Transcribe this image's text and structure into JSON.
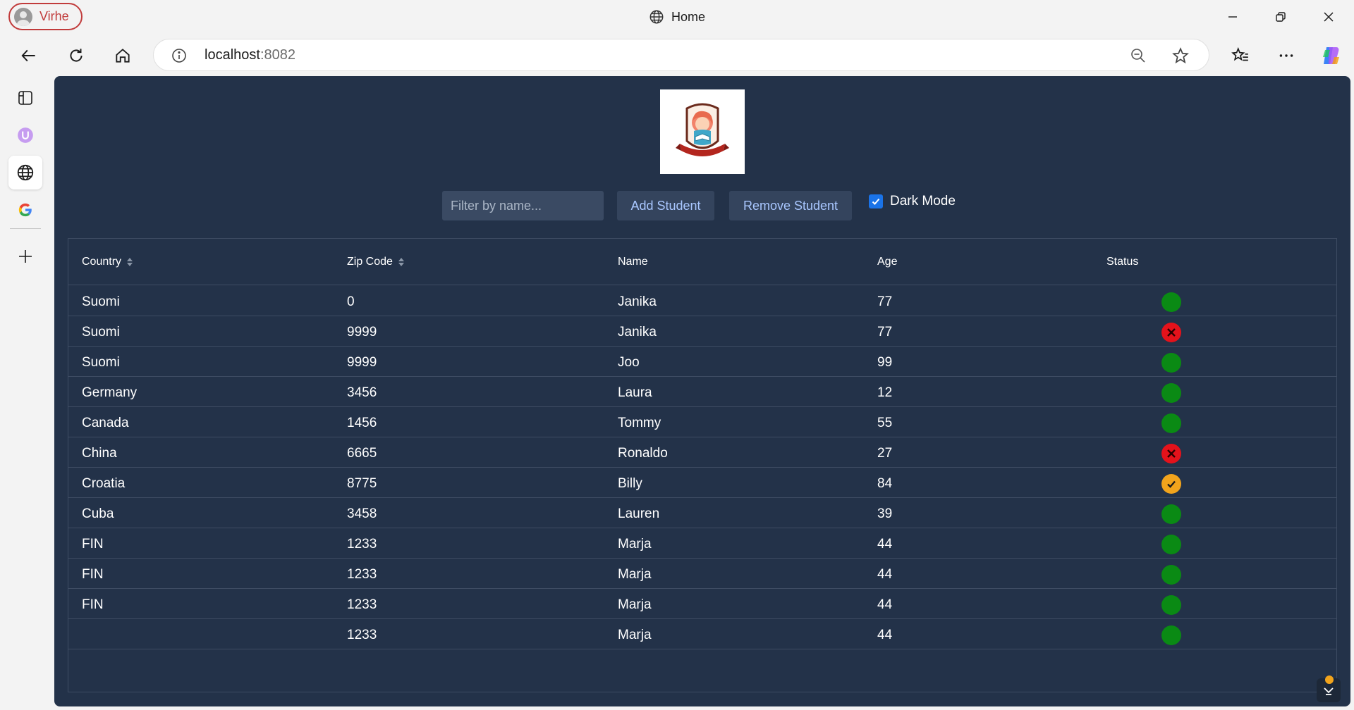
{
  "browser": {
    "profile_name": "Virhe",
    "tab_title": "Home",
    "url_host": "localhost",
    "url_port": ":8082"
  },
  "app": {
    "filter_placeholder": "Filter by name...",
    "add_label": "Add Student",
    "remove_label": "Remove Student",
    "dark_mode_label": "Dark Mode",
    "dark_mode_checked": true
  },
  "table": {
    "headers": [
      "Country",
      "Zip Code",
      "Name",
      "Age",
      "Status"
    ],
    "rows": [
      {
        "country": "Suomi",
        "zip": "0",
        "name": "Janika",
        "age": "77",
        "status": "ok"
      },
      {
        "country": "Suomi",
        "zip": "9999",
        "name": "Janika",
        "age": "77",
        "status": "err"
      },
      {
        "country": "Suomi",
        "zip": "9999",
        "name": "Joo",
        "age": "99",
        "status": "ok"
      },
      {
        "country": "Germany",
        "zip": "3456",
        "name": "Laura",
        "age": "12",
        "status": "ok"
      },
      {
        "country": "Canada",
        "zip": "1456",
        "name": "Tommy",
        "age": "55",
        "status": "ok"
      },
      {
        "country": "China",
        "zip": "6665",
        "name": "Ronaldo",
        "age": "27",
        "status": "err"
      },
      {
        "country": "Croatia",
        "zip": "8775",
        "name": "Billy",
        "age": "84",
        "status": "warn"
      },
      {
        "country": "Cuba",
        "zip": "3458",
        "name": "Lauren",
        "age": "39",
        "status": "ok"
      },
      {
        "country": "FIN",
        "zip": "1233",
        "name": "Marja",
        "age": "44",
        "status": "ok"
      },
      {
        "country": "FIN",
        "zip": "1233",
        "name": "Marja",
        "age": "44",
        "status": "ok"
      },
      {
        "country": "FIN",
        "zip": "1233",
        "name": "Marja",
        "age": "44",
        "status": "ok"
      },
      {
        "country": "",
        "zip": "1233",
        "name": "Marja",
        "age": "44",
        "status": "ok"
      }
    ]
  },
  "colors": {
    "page_bg": "#233249",
    "status_ok": "#0a8a14",
    "status_err": "#e4121b",
    "status_warn": "#f2a41c"
  }
}
